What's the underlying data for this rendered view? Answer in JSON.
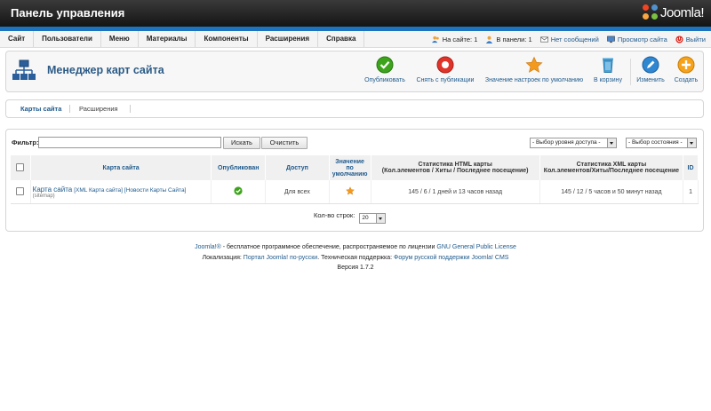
{
  "header": {
    "title": "Панель управления",
    "logo_text": "Joomla!"
  },
  "menu": [
    "Сайт",
    "Пользователи",
    "Меню",
    "Материалы",
    "Компоненты",
    "Расширения",
    "Справка"
  ],
  "status": {
    "on_site": "На сайте: 1",
    "in_admin": "В панели: 1",
    "messages": "Нет сообщений",
    "view_site": "Просмотр сайта",
    "logout": "Выйти"
  },
  "toolbar": {
    "page_title": "Менеджер карт сайта",
    "publish": "Опубликовать",
    "unpublish": "Снять с публикации",
    "default": "Значение настроек по умолчанию",
    "trash": "В корзину",
    "edit": "Изменить",
    "new": "Создать"
  },
  "submenu": {
    "tab1": "Карты сайта",
    "tab2": "Расширения"
  },
  "filter": {
    "label": "Фильтр:",
    "value": "",
    "search_button": "Искать",
    "clear_button": "Очистить",
    "access_select": "- Выбор уровня доступа -",
    "state_select": "- Выбор состояния -"
  },
  "table": {
    "headers": {
      "name": "Карта сайта",
      "published": "Опубликован",
      "access": "Доступ",
      "default_l1": "Значение",
      "default_l2": "по",
      "default_l3": "умолчанию",
      "html_l1": "Статистика HTML карты",
      "html_l2": "(Кол.элементов / Хиты / Последнее посещение)",
      "xml_l1": "Статистика XML карты",
      "xml_l2": "Кол.элементов/Хиты/Последнее посещение",
      "id": "ID"
    },
    "rows": [
      {
        "name": "Карта сайта",
        "xml_link": "[XML Карта сайта]",
        "news_link": "[Новости Карты Сайта]",
        "alias": "(sitemap)",
        "access": "Для всех",
        "html_stats": "145 / 6 / 1 дней и 13 часов назад",
        "xml_stats": "145 / 12 / 5 часов и 50 минут назад",
        "id": "1"
      }
    ]
  },
  "pagination": {
    "label": "Кол-во строк:",
    "value": "20"
  },
  "footer": {
    "l1_link": "Joomla!®",
    "l1_text": " - бесплатное программное обеспечение, распространяемое по лицензии ",
    "l1_license": "GNU General Public License",
    "l2_text1": "Локализация: ",
    "l2_link1": "Портал Joomla! по-русски",
    "l2_text2": ". Техническая поддержка: ",
    "l2_link2": "Форум русской поддержки Joomla! CMS",
    "version": "Версия 1.7.2"
  },
  "colors": {
    "accent": "#1e73be",
    "link": "#1f5a8c",
    "title": "#2c5b86",
    "header_bg": "#1a1a1a"
  }
}
